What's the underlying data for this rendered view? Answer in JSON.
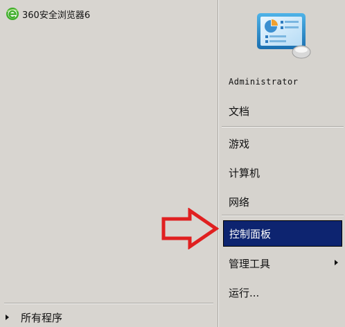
{
  "pinned": {
    "browser_label": "360安全浏览器6"
  },
  "all_programs_label": "所有程序",
  "right_menu": {
    "username": "Administrator",
    "items": [
      {
        "label": "文档"
      },
      {
        "label": "游戏"
      },
      {
        "label": "计算机"
      },
      {
        "label": "网络"
      },
      {
        "label": "控制面板",
        "selected": true
      },
      {
        "label": "管理工具",
        "has_submenu": true
      },
      {
        "label": "运行..."
      }
    ]
  },
  "colors": {
    "selected_bg": "#0d2470",
    "annotation_arrow": "#e02020"
  }
}
